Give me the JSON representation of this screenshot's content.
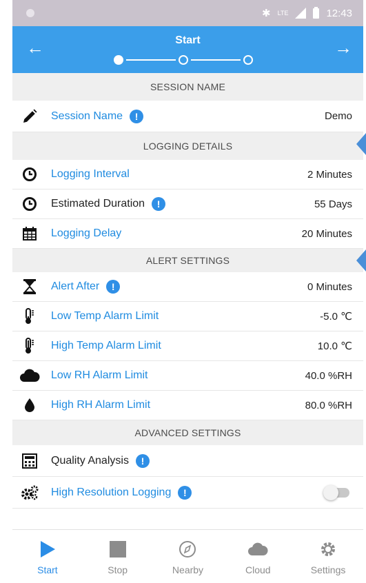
{
  "status_bar": {
    "time": "12:43",
    "network": "LTE"
  },
  "app_bar": {
    "title": "Start",
    "back_icon": "arrow-left-icon",
    "forward_icon": "arrow-right-icon",
    "steps_total": 3,
    "current_step": 1
  },
  "sections": {
    "session_name": {
      "header": "SESSION NAME",
      "session_label": "Session Name",
      "session_value": "Demo"
    },
    "logging_details": {
      "header": "LOGGING DETAILS",
      "interval_label": "Logging Interval",
      "interval_value": "2 Minutes",
      "duration_label": "Estimated Duration",
      "duration_value": "55 Days",
      "delay_label": "Logging Delay",
      "delay_value": "20 Minutes"
    },
    "alert_settings": {
      "header": "ALERT SETTINGS",
      "alert_after_label": "Alert After",
      "alert_after_value": "0 Minutes",
      "low_temp_label": "Low Temp Alarm Limit",
      "low_temp_value": "-5.0 ℃",
      "high_temp_label": "High Temp Alarm Limit",
      "high_temp_value": "10.0 ℃",
      "low_rh_label": "Low RH Alarm Limit",
      "low_rh_value": "40.0 %RH",
      "high_rh_label": "High RH Alarm Limit",
      "high_rh_value": "80.0 %RH"
    },
    "advanced_settings": {
      "header": "ADVANCED SETTINGS",
      "quality_label": "Quality Analysis",
      "high_res_label": "High Resolution Logging",
      "high_res_enabled": false
    }
  },
  "info_badge": "!",
  "bottom_nav": {
    "start": "Start",
    "stop": "Stop",
    "nearby": "Nearby",
    "cloud": "Cloud",
    "settings": "Settings",
    "active": "Start"
  },
  "colors": {
    "accent": "#3b9eea",
    "link": "#1f8be0",
    "section_bg": "#efefef",
    "status_bar": "#c9c2cc"
  }
}
